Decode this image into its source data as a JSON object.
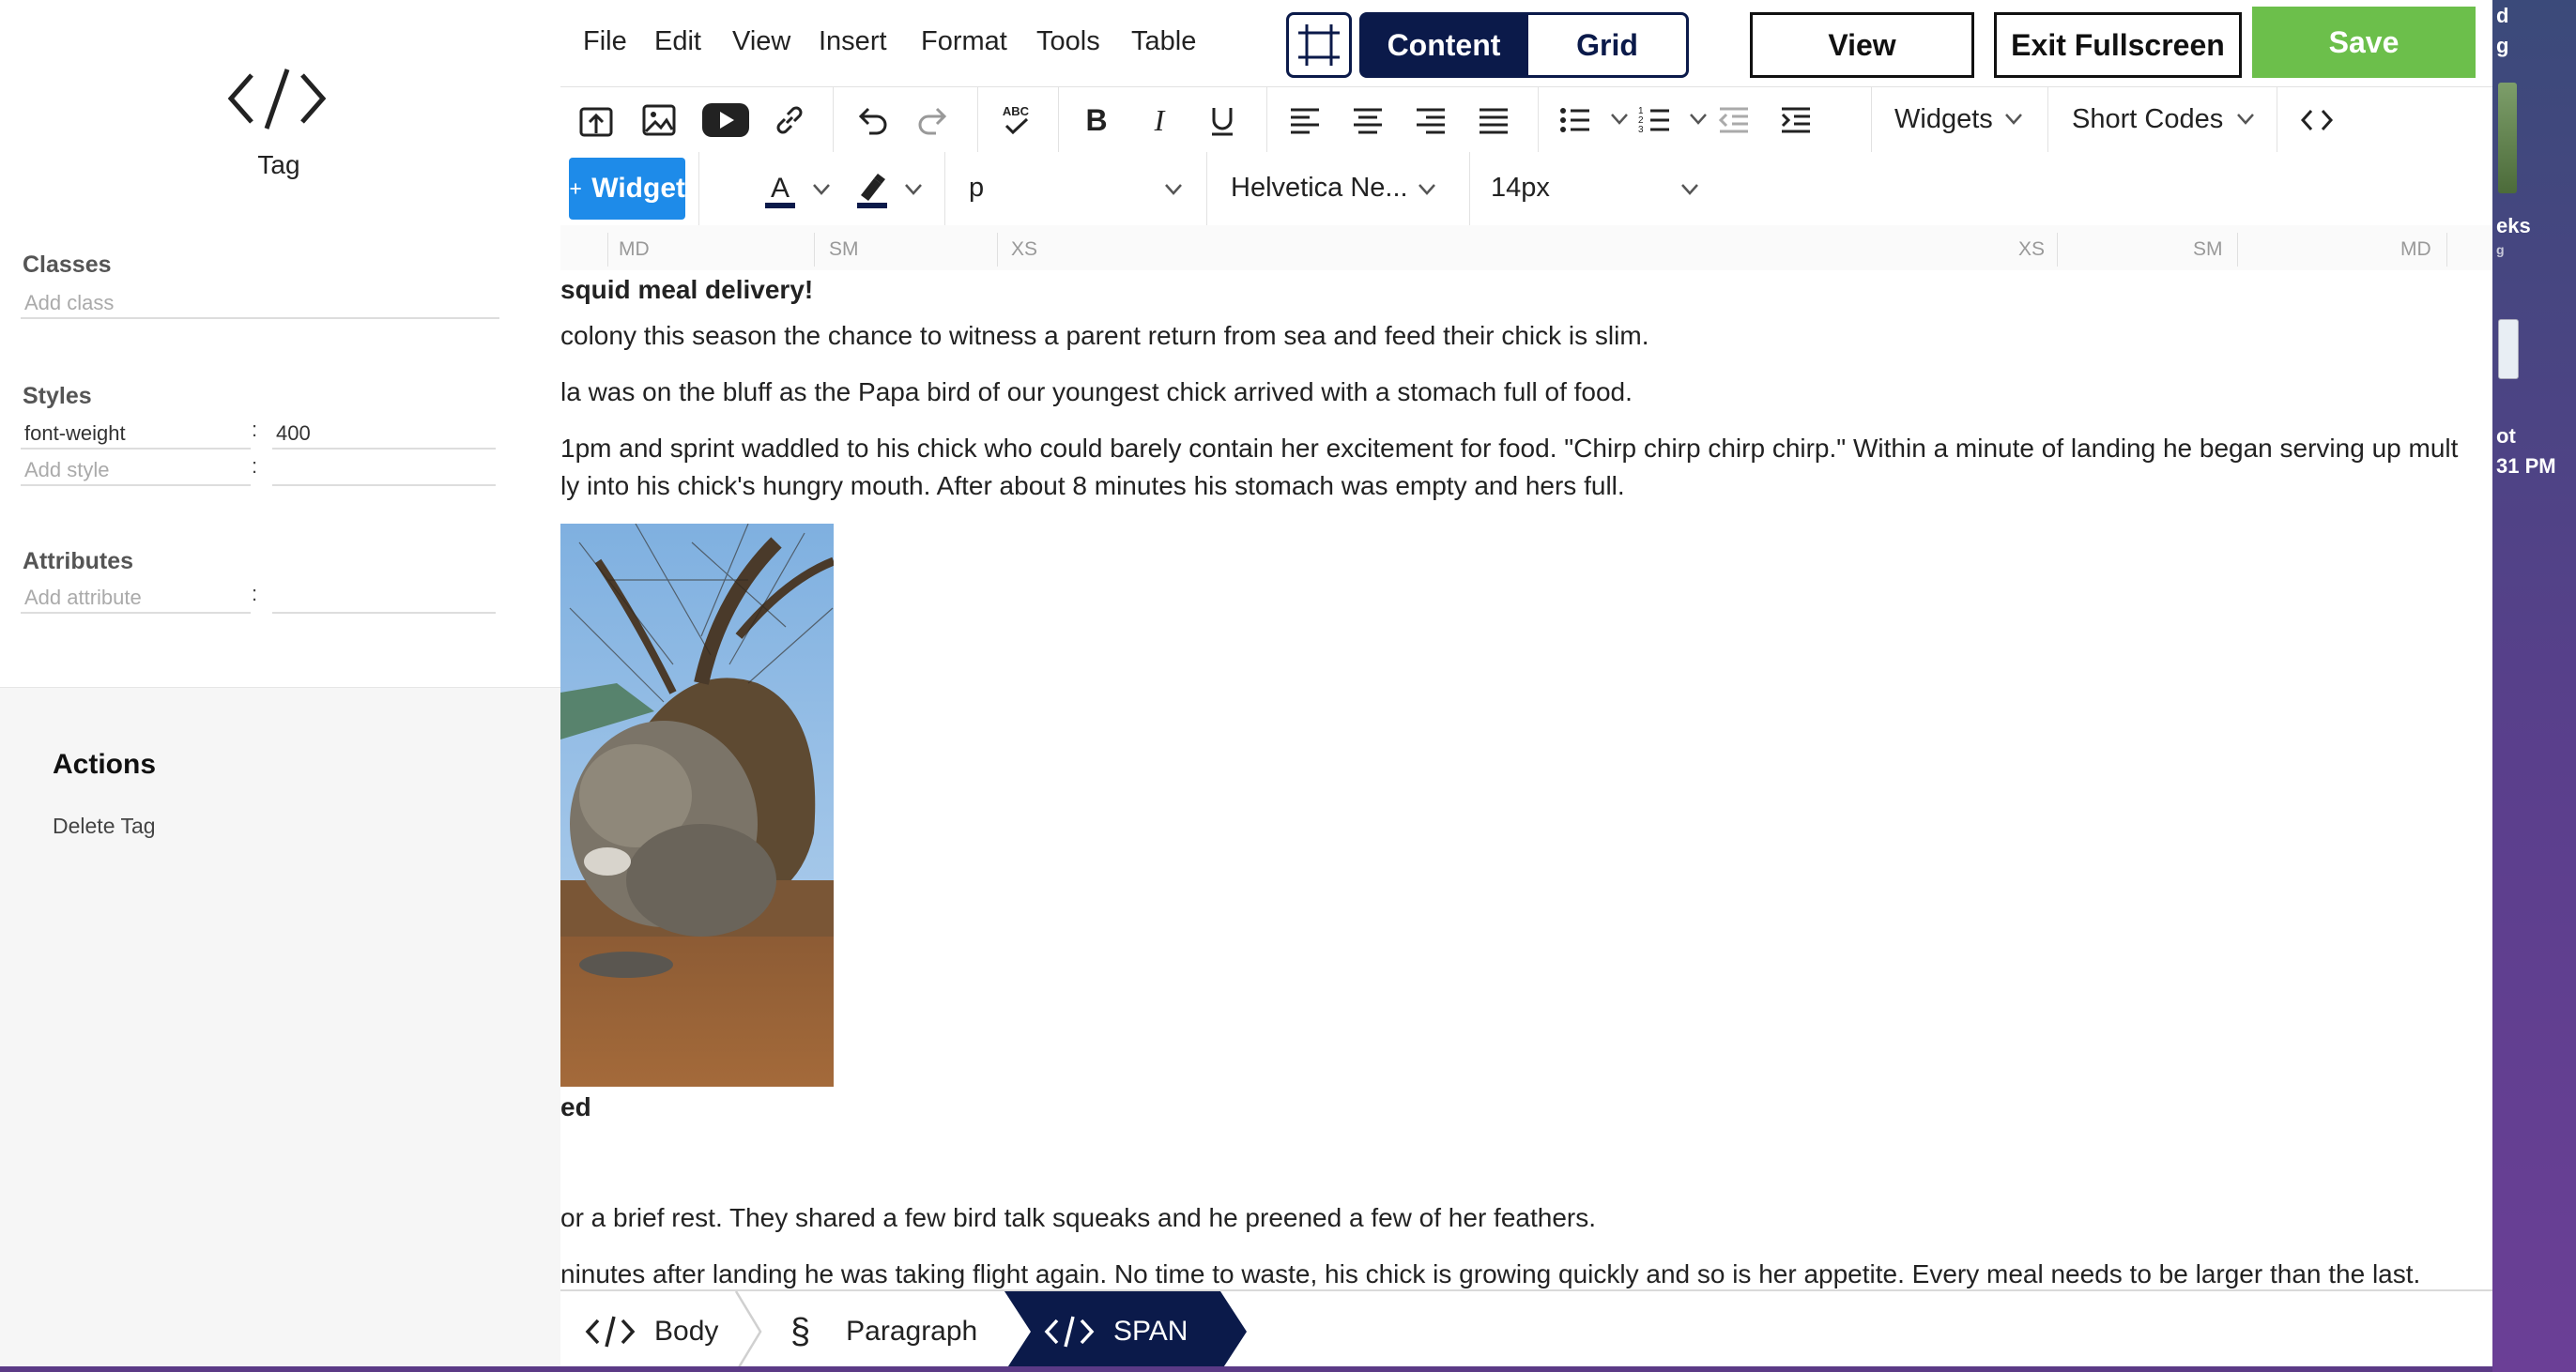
{
  "left_panel": {
    "tag_label": "Tag",
    "classes": {
      "heading": "Classes",
      "placeholder": "Add class"
    },
    "styles": {
      "heading": "Styles",
      "rows": [
        {
          "property": "font-weight",
          "value": "400"
        }
      ],
      "add_placeholder": "Add style"
    },
    "attributes": {
      "heading": "Attributes",
      "add_placeholder": "Add attribute"
    },
    "actions": {
      "heading": "Actions",
      "delete_label": "Delete Tag"
    }
  },
  "menubar": {
    "items": [
      "File",
      "Edit",
      "View",
      "Insert",
      "Format",
      "Tools",
      "Table"
    ],
    "content_label": "Content",
    "grid_label": "Grid",
    "view_label": "View",
    "exit_fullscreen_label": "Exit Fullscreen",
    "save_label": "Save"
  },
  "toolbar": {
    "widgets_label": "Widgets",
    "short_codes_label": "Short Codes",
    "add_widget_label": "Widget",
    "block_format": "p",
    "font_family": "Helvetica Ne...",
    "font_size": "14px"
  },
  "ruler": {
    "left_labels": [
      "MD",
      "SM",
      "XS"
    ],
    "right_labels": [
      "XS",
      "SM",
      "MD"
    ]
  },
  "content": {
    "heading1": "squid meal delivery!",
    "para1": "colony this season the chance to witness a parent return from sea and feed their chick is slim.",
    "para2": "la was on the bluff as the Papa bird of our youngest chick arrived with a stomach full of food.",
    "para3a": "1pm and sprint waddled to his chick who could barely contain her excitement for food. \"Chirp chirp chirp chirp.\" Within a minute of landing he began serving up mult",
    "para3b": "ly into his chick's hungry mouth. After about 8 minutes his stomach was empty and hers full.",
    "heading2": "ed",
    "para4": "or a brief rest. They shared a few bird talk squeaks and he preened a few of her feathers.",
    "para5": "ninutes after landing he was taking flight again. No time to waste, his chick is growing quickly and so is her appetite. Every meal needs to be larger than the last."
  },
  "breadcrumb": {
    "items": [
      "Body",
      "Paragraph",
      "SPAN"
    ]
  },
  "desktop": {
    "lines": [
      "d",
      "g",
      "eks",
      "g",
      "ot",
      "31 PM"
    ]
  },
  "colors": {
    "navy": "#0b1a4a",
    "save_green": "#6cbf4b",
    "widget_blue": "#1e8be9",
    "desktop_purple": "#5b3a86"
  }
}
